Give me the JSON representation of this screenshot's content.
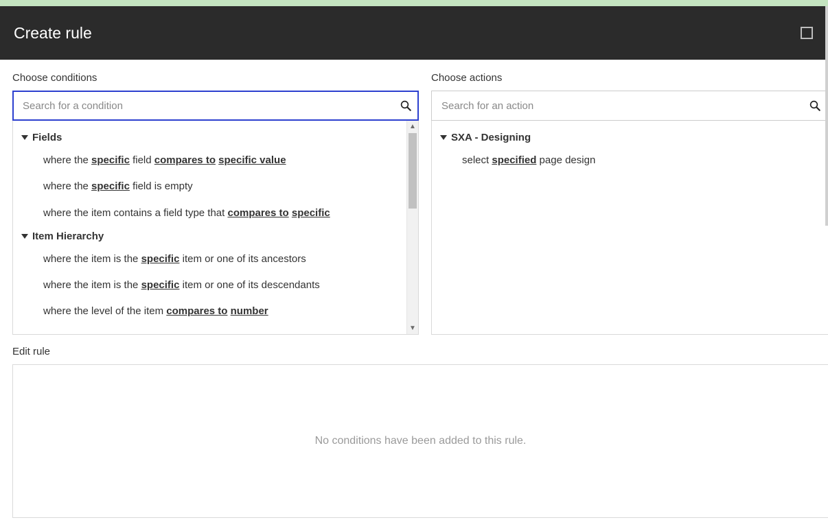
{
  "header": {
    "title": "Create rule"
  },
  "conditions": {
    "label": "Choose conditions",
    "search_placeholder": "Search for a condition",
    "groups": [
      {
        "name": "Fields",
        "items": [
          {
            "parts": [
              "where the ",
              {
                "tok": "specific"
              },
              " field ",
              {
                "tok": "compares to"
              },
              " ",
              {
                "tok": "specific value"
              }
            ]
          },
          {
            "parts": [
              "where the ",
              {
                "tok": "specific"
              },
              " field is empty"
            ]
          },
          {
            "parts": [
              "where the item contains a field type that ",
              {
                "tok": "compares to"
              },
              " ",
              {
                "tok": "specific"
              }
            ]
          }
        ]
      },
      {
        "name": "Item Hierarchy",
        "items": [
          {
            "parts": [
              "where the item is the ",
              {
                "tok": "specific"
              },
              " item or one of its ancestors"
            ]
          },
          {
            "parts": [
              "where the item is the ",
              {
                "tok": "specific"
              },
              " item or one of its descendants"
            ]
          },
          {
            "parts": [
              "where the level of the item ",
              {
                "tok": "compares to"
              },
              " ",
              {
                "tok": "number"
              }
            ]
          }
        ]
      }
    ]
  },
  "actions": {
    "label": "Choose actions",
    "search_placeholder": "Search for an action",
    "groups": [
      {
        "name": "SXA - Designing",
        "items": [
          {
            "parts": [
              "select ",
              {
                "tok": "specified"
              },
              " page design"
            ]
          }
        ]
      }
    ]
  },
  "edit": {
    "label": "Edit rule",
    "empty_message": "No conditions have been added to this rule."
  }
}
